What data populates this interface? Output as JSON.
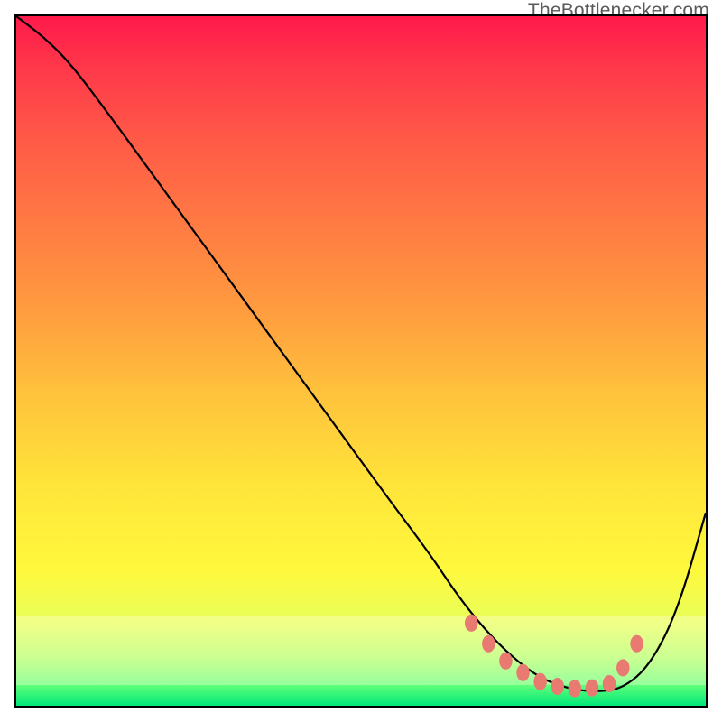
{
  "watermark": "TheBottlenecker.com",
  "colors": {
    "curve": "#000000",
    "dots": "#e87a72",
    "border": "#000000"
  },
  "chart_data": {
    "type": "line",
    "title": "",
    "xlabel": "",
    "ylabel": "",
    "xlim": [
      0,
      100
    ],
    "ylim": [
      0,
      100
    ],
    "series": [
      {
        "name": "bottleneck-curve",
        "x": [
          0,
          4,
          8,
          14,
          22,
          30,
          38,
          46,
          54,
          60,
          64,
          68,
          72,
          76,
          80,
          84,
          88,
          92,
          96,
          100
        ],
        "y": [
          100,
          97,
          93,
          85,
          74,
          63,
          52,
          41,
          30,
          22,
          16,
          11,
          7,
          4,
          2.5,
          2,
          2.5,
          6,
          14,
          28
        ]
      }
    ],
    "highlight_points": {
      "name": "valley-dots",
      "x": [
        66,
        68.5,
        71,
        73.5,
        76,
        78.5,
        81,
        83.5,
        86,
        88,
        90
      ],
      "y": [
        12,
        9,
        6.5,
        4.8,
        3.5,
        2.8,
        2.5,
        2.6,
        3.2,
        5.5,
        9
      ]
    }
  }
}
